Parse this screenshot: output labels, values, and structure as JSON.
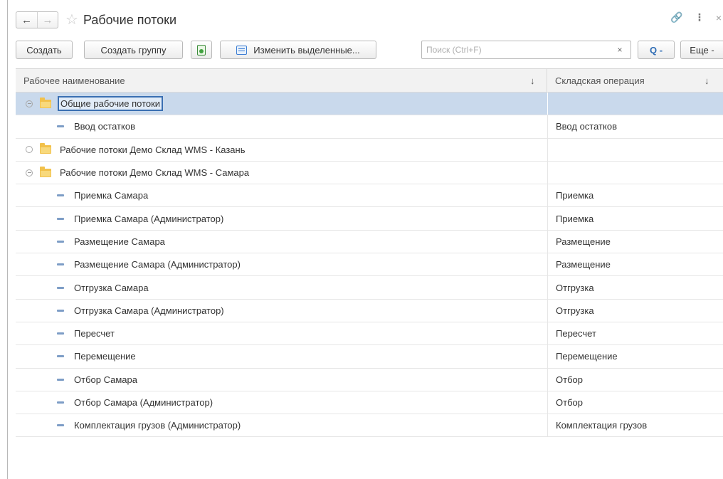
{
  "window": {
    "title": "Рабочие потоки",
    "icons": [
      "back-arrow-icon",
      "forward-arrow-icon",
      "star-icon",
      "link-icon",
      "more-vert-icon",
      "close-icon"
    ]
  },
  "toolbar": {
    "create_label": "Создать",
    "create_group_label": "Создать группу",
    "edit_selected_label": "Изменить выделенные...",
    "search_placeholder": "Поиск (Ctrl+F)",
    "clear_label": "×",
    "search_label": "Q -",
    "more_label": "Еще -"
  },
  "table": {
    "columns": [
      {
        "label": "Рабочее наименование",
        "sort": "↓"
      },
      {
        "label": "Складская операция",
        "sort": "↓"
      }
    ],
    "rows": [
      {
        "type": "group",
        "expanded": true,
        "selected": true,
        "name": "Общие рабочие потоки",
        "operation": ""
      },
      {
        "type": "item",
        "name": "Ввод остатков",
        "operation": "Ввод остатков"
      },
      {
        "type": "group",
        "expanded": false,
        "selected": false,
        "name": "Рабочие потоки Демо Склад WMS - Казань",
        "operation": ""
      },
      {
        "type": "group",
        "expanded": true,
        "selected": false,
        "name": "Рабочие потоки Демо Склад WMS - Самара",
        "operation": ""
      },
      {
        "type": "item",
        "name": "Приемка Самара",
        "operation": "Приемка"
      },
      {
        "type": "item",
        "name": "Приемка Самара (Администратор)",
        "operation": "Приемка"
      },
      {
        "type": "item",
        "name": "Размещение Самара",
        "operation": "Размещение"
      },
      {
        "type": "item",
        "name": "Размещение Самара (Администратор)",
        "operation": "Размещение"
      },
      {
        "type": "item",
        "name": "Отгрузка Самара",
        "operation": "Отгрузка"
      },
      {
        "type": "item",
        "name": "Отгрузка Самара (Администратор)",
        "operation": "Отгрузка"
      },
      {
        "type": "item",
        "name": "Пересчет",
        "operation": "Пересчет"
      },
      {
        "type": "item",
        "name": "Перемещение",
        "operation": "Перемещение"
      },
      {
        "type": "item",
        "name": "Отбор Самара",
        "operation": "Отбор"
      },
      {
        "type": "item",
        "name": "Отбор Самара (Администратор)",
        "operation": "Отбор"
      },
      {
        "type": "item",
        "name": "Комплектация грузов (Администратор)",
        "operation": "Комплектация грузов"
      }
    ]
  }
}
